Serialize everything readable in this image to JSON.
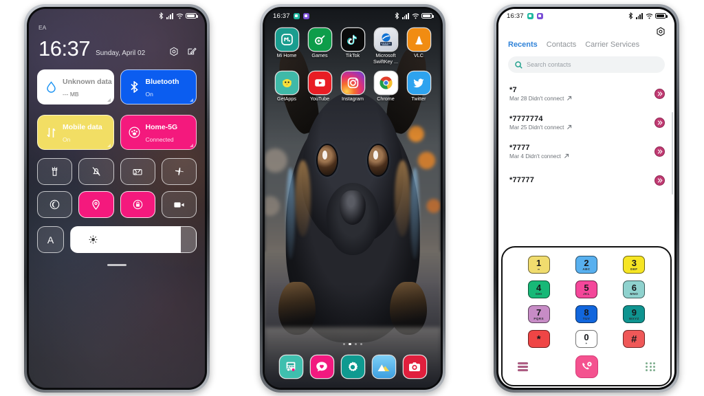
{
  "phone1": {
    "statusbar": {
      "carrier": "EA",
      "icons": [
        "bluetooth-icon",
        "signal-icon",
        "wifi-icon",
        "battery-icon"
      ]
    },
    "clock": {
      "time": "16:37",
      "date": "Sunday, April 02"
    },
    "header_icons": [
      "settings-hex-icon",
      "edit-icon"
    ],
    "big_tiles": [
      {
        "name": "data-usage",
        "title": "Unknown data pl...",
        "sub": "--- MB",
        "icon": "water-drop-icon",
        "color": "#ffffff"
      },
      {
        "name": "bluetooth",
        "title": "Bluetooth",
        "sub": "On",
        "icon": "bluetooth-icon",
        "color": "#0b5df0"
      },
      {
        "name": "mobile-data",
        "title": "Mobile data",
        "sub": "On",
        "icon": "data-arrows-icon",
        "color": "#f2de64"
      },
      {
        "name": "wifi",
        "title": "Home-5G",
        "sub": "Connected",
        "icon": "paw-wifi-icon",
        "color": "#f4197d"
      }
    ],
    "toggles": [
      {
        "name": "flashlight",
        "icon": "flashlight-icon",
        "on": false
      },
      {
        "name": "silent",
        "icon": "bell-off-icon",
        "on": false
      },
      {
        "name": "screenshot",
        "icon": "screenshot-icon",
        "on": false
      },
      {
        "name": "airplane-mode",
        "icon": "airplane-icon",
        "on": false
      },
      {
        "name": "dark-mode",
        "icon": "moon-icon",
        "on": false
      },
      {
        "name": "location",
        "icon": "location-pin-icon",
        "on": true
      },
      {
        "name": "auto-rotate",
        "icon": "rotate-lock-icon",
        "on": true
      },
      {
        "name": "screen-recorder",
        "icon": "video-camera-icon",
        "on": false
      }
    ],
    "font_button": "A",
    "brightness": {
      "icon": "brightness-icon",
      "level": 88
    }
  },
  "phone2": {
    "statusbar": {
      "time": "16:37",
      "badges": [
        "teal-app-badge",
        "violet-app-badge"
      ],
      "icons": [
        "bluetooth-icon",
        "signal-icon",
        "wifi-icon",
        "battery-icon"
      ]
    },
    "apps_row1": [
      {
        "label": "Mi Home",
        "icon": "mi-home-icon",
        "bg": "#1a9d8f"
      },
      {
        "label": "Games",
        "icon": "games-icon",
        "bg": "#0e9d4a"
      },
      {
        "label": "TikTok",
        "icon": "tiktok-icon",
        "bg": "#0a0a0a"
      },
      {
        "label": "Microsoft SwiftKey ...",
        "icon": "swiftkey-icon",
        "bg": "#e7e9ee"
      },
      {
        "label": "VLC",
        "icon": "vlc-icon",
        "bg": "#f18c12"
      }
    ],
    "apps_row2": [
      {
        "label": "GetApps",
        "icon": "getapps-icon",
        "bg": "#3fb9a8"
      },
      {
        "label": "YouTube",
        "icon": "youtube-icon",
        "bg": "#e81d24"
      },
      {
        "label": "Instagram",
        "icon": "instagram-icon",
        "bg": "#d6249f"
      },
      {
        "label": "Chrome",
        "icon": "chrome-icon",
        "bg": "#ffffff"
      },
      {
        "label": "Twitter",
        "icon": "twitter-icon",
        "bg": "#2ea3ef"
      }
    ],
    "page_dots": {
      "count": 4,
      "active": 1
    },
    "dock": [
      {
        "label": "Phone",
        "icon": "dialer-icon",
        "bg": "#3fbfae"
      },
      {
        "label": "Messages",
        "icon": "message-heart-icon",
        "bg": "#f2197f"
      },
      {
        "label": "Settings",
        "icon": "gear-icon",
        "bg": "#0f9a90"
      },
      {
        "label": "Gallery",
        "icon": "mountain-icon",
        "bg": "#62bdf0"
      },
      {
        "label": "Camera",
        "icon": "camera-icon",
        "bg": "#e01f3d"
      }
    ]
  },
  "phone3": {
    "statusbar": {
      "time": "16:37",
      "badges": [
        "teal-app-badge",
        "violet-app-badge"
      ],
      "icons": [
        "bluetooth-icon",
        "signal-icon",
        "wifi-icon",
        "battery-icon"
      ]
    },
    "gear": "settings-hex-icon",
    "tabs": [
      {
        "label": "Recents",
        "active": true
      },
      {
        "label": "Contacts",
        "active": false
      },
      {
        "label": "Carrier Services",
        "active": false
      }
    ],
    "search_placeholder": "Search contacts",
    "search_icon": "search-icon",
    "calls": [
      {
        "number": "*7",
        "detail": "Mar 28 Didn't connect",
        "direction": "outgoing-arrow-icon",
        "badge": "chevrons-right-icon"
      },
      {
        "number": "*7777774",
        "detail": "Mar 25 Didn't connect",
        "direction": "outgoing-arrow-icon",
        "badge": "chevrons-right-icon"
      },
      {
        "number": "*7777",
        "detail": "Mar 4 Didn't connect",
        "direction": "outgoing-arrow-icon",
        "badge": "chevrons-right-icon"
      },
      {
        "number": "*77777",
        "detail": "",
        "direction": "outgoing-arrow-icon",
        "badge": "chevrons-right-icon"
      }
    ],
    "keys": [
      {
        "n": "1",
        "s": "∞",
        "bg": "#f0dc6e",
        "sub_icon": "voicemail-icon"
      },
      {
        "n": "2",
        "s": "ABC",
        "bg": "#58b0ef"
      },
      {
        "n": "3",
        "s": "DEF",
        "bg": "#f6e524"
      },
      {
        "n": "4",
        "s": "GHI",
        "bg": "#17b877"
      },
      {
        "n": "5",
        "s": "JKL",
        "bg": "#f4479a"
      },
      {
        "n": "6",
        "s": "MNO",
        "bg": "#8fd2ce"
      },
      {
        "n": "7",
        "s": "PQRS",
        "bg": "#c78cc6"
      },
      {
        "n": "8",
        "s": "TUV",
        "bg": "#1166dd"
      },
      {
        "n": "9",
        "s": "WXYZ",
        "bg": "#0f9490"
      },
      {
        "n": "*",
        "s": "",
        "bg": "#ef4545"
      },
      {
        "n": "0",
        "s": "+",
        "bg": "#ffffff"
      },
      {
        "n": "#",
        "s": "",
        "bg": "#ef5858"
      }
    ],
    "pad_actions": {
      "left_icon": "menu-lines-icon",
      "call_icon": "call-add-icon",
      "right_icon": "keypad-dots-icon"
    }
  }
}
